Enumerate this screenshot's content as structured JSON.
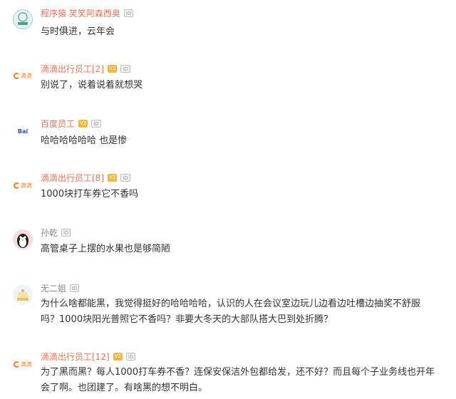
{
  "comments": [
    {
      "user": "程序猿 笑笑阿森西奥",
      "text": "与时俱进，云年会",
      "avatar_label": "程序猿",
      "vip": false
    },
    {
      "user": "滴滴出行员工[2]",
      "text": "别说了，说着说着就想哭",
      "avatar_label": "滴滴",
      "vip": true
    },
    {
      "user": "百度员工",
      "text": "哈哈哈哈哈哈 也是惨",
      "avatar_label": "Bai",
      "vip": true
    },
    {
      "user": "滴滴出行员工[8]",
      "text": "1000块打车券它不香吗",
      "avatar_label": "滴滴",
      "vip": true
    },
    {
      "user": "孙乾",
      "text": "高管桌子上摆的水果也是够简陋",
      "vip": false
    },
    {
      "user": "无二姐",
      "text_lines": [
        "为什么啥都能黑，我觉得挺好的哈哈哈哈，认识的人在会议室边玩儿边看边吐槽边抽奖不舒服",
        "吗？1000块阳光普照它不香吗？非要大冬天的大部队搭大巴到处折腾？"
      ],
      "vip": false
    },
    {
      "user": "滴滴出行员工[12]",
      "text_lines": [
        "为了黑而黑？每人1000打车券不香？连保安保洁外包都给发，还不好？而且每个子业务线也开年",
        "会了啊。也团建了。有啥黑的想不明白。"
      ],
      "avatar_label": "滴滴",
      "vip": true
    }
  ],
  "badges": {
    "vip": "V2",
    "id": "ID"
  },
  "colors": {
    "username": "#eb7350",
    "text": "#333333",
    "vip_badge": "#f4b73b"
  }
}
